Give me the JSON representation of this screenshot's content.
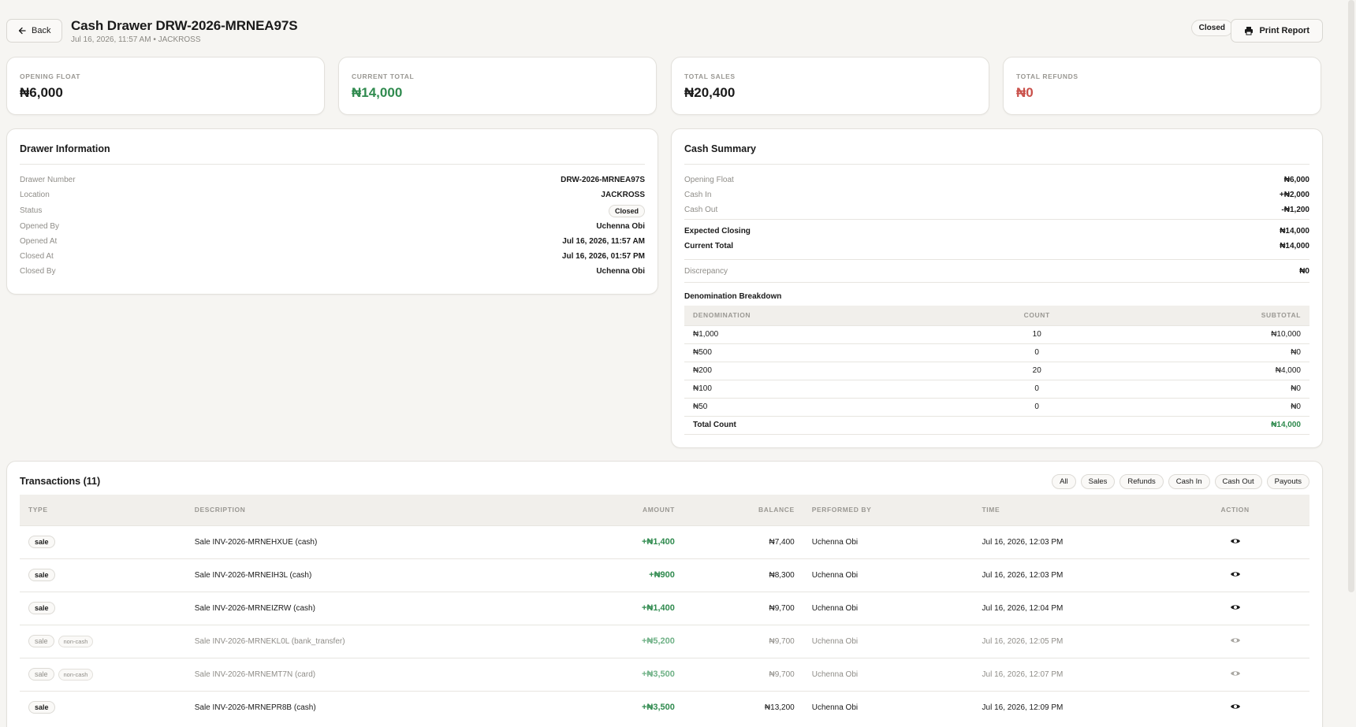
{
  "header": {
    "back_label": "Back",
    "title": "Cash Drawer DRW-2026-MRNEA97S",
    "subtitle": "Jul 16, 2026, 11:57 AM • JACKROSS",
    "status": "Closed",
    "print_label": "Print Report"
  },
  "stats": [
    {
      "label": "Opening Float",
      "value": "₦6,000"
    },
    {
      "label": "Current Total",
      "value": "₦14,000"
    },
    {
      "label": "Total Sales",
      "value": "₦20,400"
    },
    {
      "label": "Total Refunds",
      "value": "₦0"
    }
  ],
  "drawer_info": {
    "title": "Drawer Information",
    "rows": [
      {
        "k": "Drawer Number",
        "v": "DRW-2026-MRNEA97S"
      },
      {
        "k": "Location",
        "v": "JACKROSS"
      },
      {
        "k": "Status",
        "v": "Closed"
      },
      {
        "k": "Opened By",
        "v": "Uchenna Obi"
      },
      {
        "k": "Opened At",
        "v": "Jul 16, 2026, 11:57 AM"
      },
      {
        "k": "Closed At",
        "v": "Jul 16, 2026, 01:57 PM"
      },
      {
        "k": "Closed By",
        "v": "Uchenna Obi"
      }
    ]
  },
  "cash_summary": {
    "title": "Cash Summary",
    "opening_float": {
      "k": "Opening Float",
      "v": "₦6,000"
    },
    "cash_in": {
      "k": "Cash In",
      "v": "+₦2,000"
    },
    "cash_out": {
      "k": "Cash Out",
      "v": "-₦1,200"
    },
    "expected_closing": {
      "k": "Expected Closing",
      "v": "₦14,000"
    },
    "current_total": {
      "k": "Current Total",
      "v": "₦14,000"
    },
    "discrepancy": {
      "k": "Discrepancy",
      "v": "₦0"
    },
    "denom_title": "Denomination Breakdown",
    "denom_headers": [
      "Denomination",
      "Count",
      "Subtotal"
    ],
    "denoms": [
      {
        "d": "₦1,000",
        "c": "10",
        "s": "₦10,000"
      },
      {
        "d": "₦500",
        "c": "0",
        "s": "₦0"
      },
      {
        "d": "₦200",
        "c": "20",
        "s": "₦4,000"
      },
      {
        "d": "₦100",
        "c": "0",
        "s": "₦0"
      },
      {
        "d": "₦50",
        "c": "0",
        "s": "₦0"
      }
    ],
    "total_label": "Total Count",
    "total_value": "₦14,000"
  },
  "transactions": {
    "title": "Transactions (11)",
    "filters": [
      "All",
      "Sales",
      "Refunds",
      "Cash In",
      "Cash Out",
      "Payouts"
    ],
    "headers": [
      "Type",
      "Description",
      "Amount",
      "Balance",
      "Performed By",
      "Time",
      "Action"
    ],
    "non_cash_label": "non-cash",
    "rows": [
      {
        "type": "sale",
        "desc": "Sale INV-2026-MRNEHXUE (cash)",
        "amount": "+₦1,400",
        "balance": "₦7,400",
        "by": "Uchenna Obi",
        "time": "Jul 16, 2026, 12:03 PM"
      },
      {
        "type": "sale",
        "desc": "Sale INV-2026-MRNEIH3L (cash)",
        "amount": "+₦900",
        "balance": "₦8,300",
        "by": "Uchenna Obi",
        "time": "Jul 16, 2026, 12:03 PM"
      },
      {
        "type": "sale",
        "desc": "Sale INV-2026-MRNEIZRW (cash)",
        "amount": "+₦1,400",
        "balance": "₦9,700",
        "by": "Uchenna Obi",
        "time": "Jul 16, 2026, 12:04 PM"
      },
      {
        "type": "sale",
        "desc": "Sale INV-2026-MRNEKL0L (bank_transfer)",
        "amount": "+₦5,200",
        "balance": "₦9,700",
        "by": "Uchenna Obi",
        "time": "Jul 16, 2026, 12:05 PM"
      },
      {
        "type": "sale",
        "desc": "Sale INV-2026-MRNEMT7N (card)",
        "amount": "+₦3,500",
        "balance": "₦9,700",
        "by": "Uchenna Obi",
        "time": "Jul 16, 2026, 12:07 PM"
      },
      {
        "type": "sale",
        "desc": "Sale INV-2026-MRNEPR8B (cash)",
        "amount": "+₦3,500",
        "balance": "₦13,200",
        "by": "Uchenna Obi",
        "time": "Jul 16, 2026, 12:09 PM"
      }
    ]
  },
  "colors": {
    "green": "#2f8a4e",
    "red": "#c9504a",
    "orange": "#e0a030"
  }
}
